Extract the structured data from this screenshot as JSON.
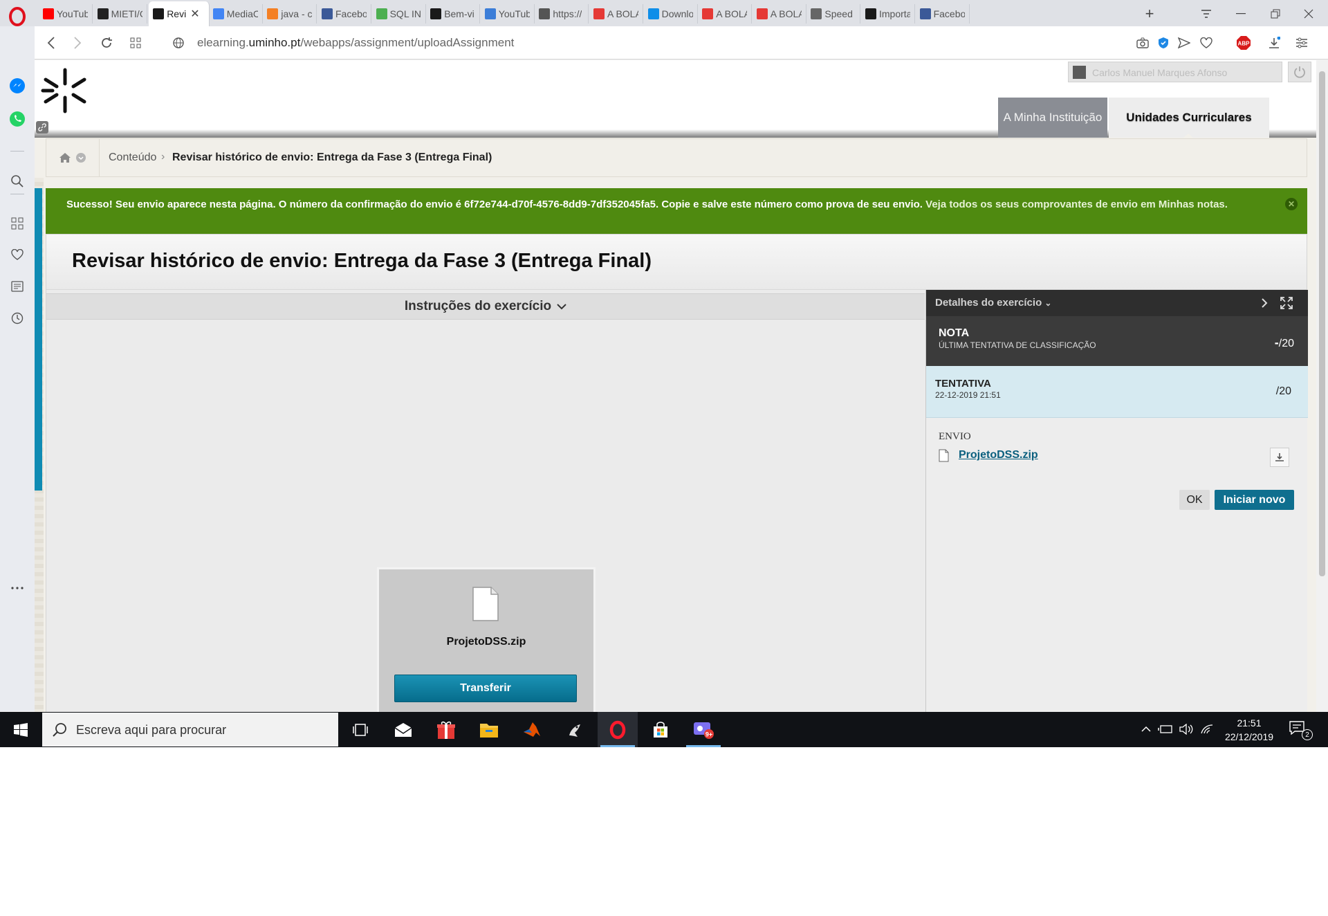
{
  "browser": {
    "tabs": [
      {
        "title": "YouTub",
        "favicon": "youtube-icon",
        "color": "#ff0000"
      },
      {
        "title": "MIETI/C",
        "favicon": "github-icon",
        "color": "#222222"
      },
      {
        "title": "Revi",
        "favicon": "blackboard-icon",
        "color": "#1a1a1a",
        "active": true
      },
      {
        "title": "MediaC",
        "favicon": "doc-icon",
        "color": "#4285f4"
      },
      {
        "title": "java - c",
        "favicon": "stackoverflow-icon",
        "color": "#f48024"
      },
      {
        "title": "Facebo",
        "favicon": "facebook-icon",
        "color": "#3b5998"
      },
      {
        "title": "SQL INS",
        "favicon": "w3schools-icon",
        "color": "#4caf50"
      },
      {
        "title": "Bem-vi",
        "favicon": "blackboard-icon",
        "color": "#1a1a1a"
      },
      {
        "title": "YouTub",
        "favicon": "cloud-download-icon",
        "color": "#3b7dd8"
      },
      {
        "title": "https://",
        "favicon": "page-icon",
        "color": "#555555"
      },
      {
        "title": "A BOLA",
        "favicon": "abola-icon",
        "color": "#e53935"
      },
      {
        "title": "Downlo",
        "favicon": "teamviewer-icon",
        "color": "#0e8ee9"
      },
      {
        "title": "A BOLA",
        "favicon": "abola-icon",
        "color": "#e53935"
      },
      {
        "title": "A BOLA",
        "favicon": "abola-icon",
        "color": "#e53935"
      },
      {
        "title": "Speed D",
        "favicon": "speed-dial-icon",
        "color": "#666666"
      },
      {
        "title": "Importa",
        "favicon": "blackboard-icon",
        "color": "#1a1a1a"
      },
      {
        "title": "Facebo",
        "favicon": "facebook-icon",
        "color": "#3b5998"
      }
    ],
    "new_tab_label": "+",
    "close_tab_label": "✕",
    "url_prefix": "elearning.",
    "url_domain": "uminho.pt",
    "url_path": "/webapps/assignment/uploadAssignment",
    "adblock_label": "ABP"
  },
  "header": {
    "user_name": "Carlos Manuel Marques Afonso",
    "tab_institution": "A Minha Instituição",
    "tab_courses": "Unidades Curriculares"
  },
  "breadcrumb": {
    "parent": "Conteúdo",
    "separator": "›",
    "current": "Revisar histórico de envio: Entrega da Fase 3 (Entrega Final)"
  },
  "success_banner": {
    "message": "Sucesso! Seu envio aparece nesta página. O número da confirmação do envio é 6f72e744-d70f-4576-8dd9-7df352045fa5. Copie e salve este número como prova de seu envio.",
    "link_text": "Veja todos os seus comprovantes de envio em Minhas notas.",
    "close_label": "✕"
  },
  "main": {
    "title": "Revisar histórico de envio: Entrega da Fase 3 (Entrega Final)",
    "instructions_label": "Instruções do exercício",
    "file_name": "ProjetoDSS.zip",
    "transfer_label": "Transferir"
  },
  "details": {
    "header_label": "Detalhes do exercício",
    "grade_label": "NOTA",
    "grade_sublabel": "ÚLTIMA TENTATIVA DE CLASSIFICAÇÃO",
    "grade_value_dash": "-",
    "grade_value_total": "/20",
    "attempt_label": "TENTATIVA",
    "attempt_date": "22-12-2019 21:51",
    "attempt_value": "/20",
    "submission_label": "ENVIO",
    "submission_file": "ProjetoDSS.zip",
    "ok_label": "OK",
    "new_attempt_label": "Iniciar novo"
  },
  "taskbar": {
    "search_placeholder": "Escreva aqui para procurar",
    "time": "21:51",
    "date": "22/12/2019",
    "notifications_count": "2",
    "badge": "9+"
  },
  "colors": {
    "success_green": "#4f8a10",
    "accent_blue": "#0f6f8f",
    "active_tab_gray": "#8a8d94"
  }
}
